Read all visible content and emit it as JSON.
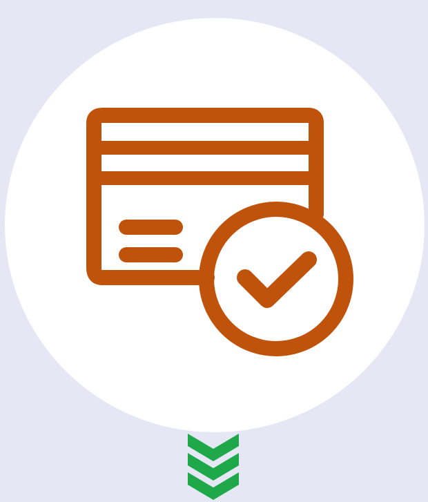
{
  "colors": {
    "background": "#e6e7f5",
    "circle": "#ffffff",
    "icon": "#c0530c",
    "chevron": "#1ea84a"
  },
  "icons": {
    "main": "credit-card-check-icon",
    "scroll": "triple-chevron-down-icon"
  }
}
